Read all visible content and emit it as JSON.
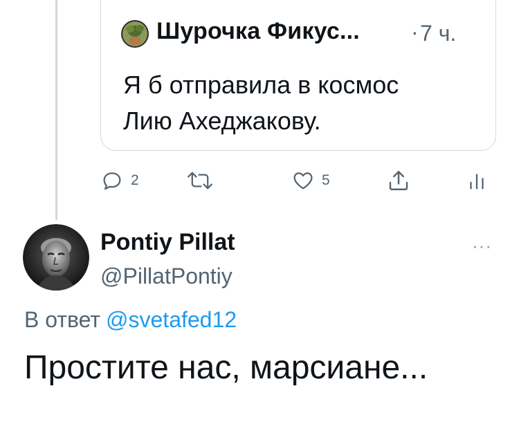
{
  "quoted_tweet": {
    "author_name": "Шурочка Фикус...",
    "separator": "·",
    "time": "7 ч.",
    "text": "Я б отправила в космос\nЛию Ахеджакову."
  },
  "actions": {
    "reply": {
      "icon": "reply-icon",
      "count": "2"
    },
    "retweet": {
      "icon": "retweet-icon"
    },
    "like": {
      "icon": "heart-icon",
      "count": "5"
    },
    "share": {
      "icon": "share-icon"
    },
    "analytics": {
      "icon": "analytics-icon"
    }
  },
  "reply_tweet": {
    "author_name": "Pontiy Pillat",
    "handle": "@PillatPontiy",
    "more": "···",
    "reply_label": "В ответ",
    "reply_mention": "@svetafed12",
    "text": "Простите нас, марсиане..."
  },
  "colors": {
    "text": "#0f1419",
    "secondary": "#536471",
    "link": "#1d9bf0",
    "border": "#cfd9de"
  }
}
